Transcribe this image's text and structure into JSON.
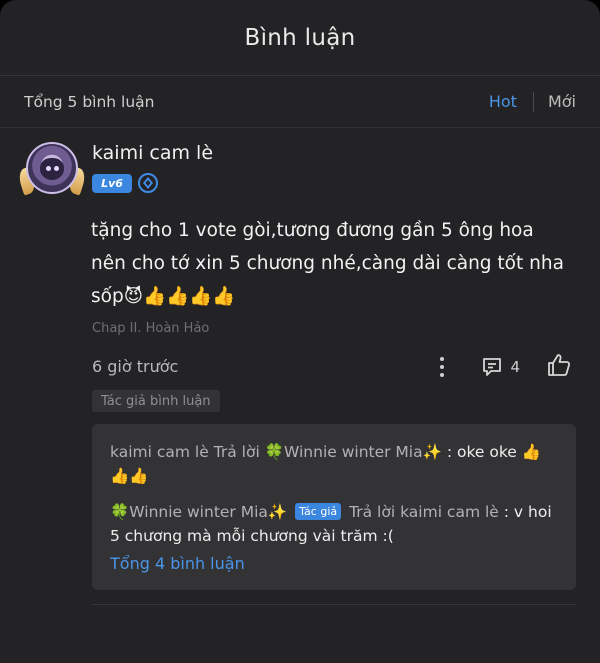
{
  "header": {
    "title": "Bình luận"
  },
  "subbar": {
    "total": "Tổng 5 bình luận",
    "sort_hot": "Hot",
    "sort_new": "Mới"
  },
  "comment": {
    "username": "kaimi cam lè",
    "level": "Lv6",
    "content": "tặng cho 1 vote gòi,tương đương gần 5 ông hoa nên cho tớ xin 5 chương nhé,càng dài càng tốt nha sốp😈👍👍👍👍",
    "chapter": "Chap II. Hoàn Hảo",
    "time": "6 giờ trước",
    "reply_count": "4",
    "author_tag": "Tác giả bình luận"
  },
  "replies": {
    "r1_author": "kaimi cam lè",
    "r1_reply_word": "Trả lời",
    "r1_target": "🍀Winnie winter Mia✨",
    "r1_text": ": oke oke 👍👍👍",
    "r2_author": "🍀Winnie winter Mia✨",
    "r2_tag": "Tác giả",
    "r2_reply_word": "Trả lời",
    "r2_target": "kaimi cam lè",
    "r2_text": ": v hoi 5 chương mà mỗi chương vài trăm :(",
    "more": "Tổng 4 bình luận"
  },
  "colors": {
    "accent": "#4a95e8",
    "background": "#232325",
    "reply_box": "#333336"
  },
  "icons": [
    "more-vertical-icon",
    "comment-icon",
    "thumbs-up-icon",
    "diamond-icon"
  ]
}
